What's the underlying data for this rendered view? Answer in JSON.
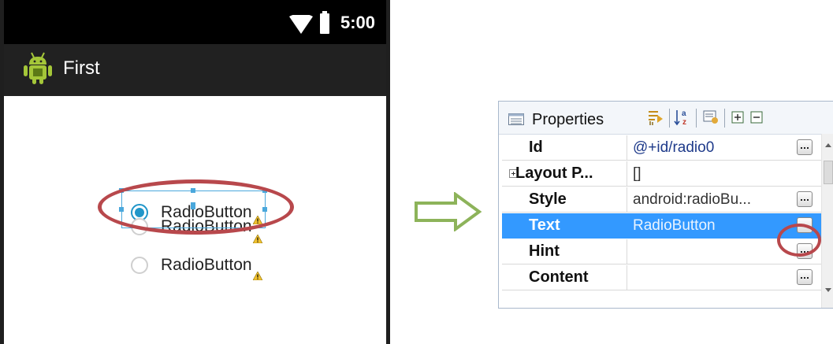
{
  "phone": {
    "status_time": "5:00",
    "app_title": "First",
    "radio_buttons": [
      {
        "label": "RadioButton",
        "checked": true
      },
      {
        "label": "RadioButton",
        "checked": false
      },
      {
        "label": "RadioButton",
        "checked": false
      }
    ]
  },
  "properties": {
    "title": "Properties",
    "rows": [
      {
        "name": "Id",
        "value": "@+id/radio0",
        "expandable": false,
        "has_button": true,
        "selected": false
      },
      {
        "name": "Layout P...",
        "value": "[]",
        "expandable": true,
        "has_button": false,
        "selected": false
      },
      {
        "name": "Style",
        "value": "android:radioBu...",
        "expandable": false,
        "has_button": true,
        "selected": false
      },
      {
        "name": "Text",
        "value": "RadioButton",
        "expandable": false,
        "has_button": true,
        "selected": true
      },
      {
        "name": "Hint",
        "value": "",
        "expandable": false,
        "has_button": true,
        "selected": false
      },
      {
        "name": "Content",
        "value": "",
        "expandable": false,
        "has_button": true,
        "selected": false
      }
    ]
  },
  "colors": {
    "selection_blue": "#3399ff",
    "highlight_red": "#b8484c",
    "arrow_green": "#8db35a",
    "radio_accent": "#2196c9"
  },
  "icons": [
    "wifi-icon",
    "battery-icon",
    "android-icon",
    "warning-icon",
    "properties-icon",
    "filter-icon",
    "sort-alpha-icon",
    "advanced-icon",
    "expand-all-icon",
    "collapse-all-icon",
    "ellipsis-icon",
    "arrow-right-icon"
  ]
}
